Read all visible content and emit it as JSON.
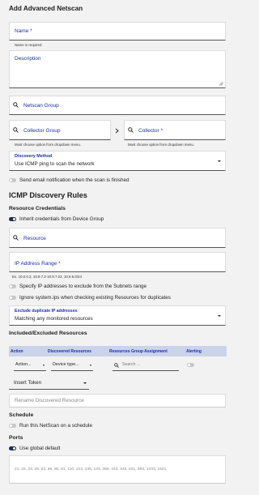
{
  "title": "Add Advanced Netscan",
  "name_field": {
    "label": "Name *",
    "helper": "Name is required"
  },
  "description_field": {
    "label": "Description"
  },
  "netscan_group": {
    "label": "Netscan Group"
  },
  "collector_group": {
    "label": "Collector Group",
    "helper": "Must choose option from dropdown menu."
  },
  "collector": {
    "label": "Collector *",
    "helper": "Must choose option from dropdown menu."
  },
  "discovery_method": {
    "label": "Discovery Method",
    "value": "Use ICMP ping to scan the network"
  },
  "email_toggle": {
    "label": "Send email notification when the scan is finished",
    "state": "off"
  },
  "icmp_heading": "ICMP Discovery Rules",
  "resource_credentials": {
    "heading": "Resource Credentials",
    "inherit_toggle": {
      "label": "Inherit credentials from Device Group",
      "state": "on"
    }
  },
  "resource_field": {
    "label": "Resource"
  },
  "ip_range": {
    "label": "IP Address Range *",
    "helper": "Ex. 10.0.0.2, 10.9.7.2-10.9.7.22, 10.9.6.0/24"
  },
  "exclude_toggle": {
    "label": "Specify IP addresses to exclude from the Subnets range",
    "state": "off"
  },
  "ignore_toggle": {
    "label": "Ignore system.ips when checking existing Resources for duplicates",
    "state": "off"
  },
  "exclude_duplicate": {
    "label": "Exclude duplicate IP addresses",
    "value": "Matching any monitored resources"
  },
  "included_excluded": {
    "heading": "Included/Excluded Resources",
    "columns": [
      "Action",
      "Discovered Resources",
      "Resources Group Assignment",
      "Alerting"
    ],
    "row": {
      "action": "Action...",
      "device_type": "Device type...",
      "search_placeholder": "Search ...",
      "alerting": "off"
    }
  },
  "insert_token": {
    "label": "Insert Token"
  },
  "rename_field": {
    "placeholder": "Rename Discovered Resource"
  },
  "schedule": {
    "heading": "Schedule",
    "toggle_label": "Run this NetScan on a schedule",
    "state": "off"
  },
  "ports": {
    "heading": "Ports",
    "toggle_label": "Use global default",
    "state": "on",
    "value": "21, 22, 23, 25, 53, 69, 80, 81, 110, 123, 135, 143, 389, 443, 445, 631, 993, 1433, 1521,"
  },
  "colors": {
    "accent": "#1a2ea8",
    "toggle_on": "#1d2b4f",
    "toggle_off": "#c7c7c7",
    "background": "#f2f2f3"
  }
}
